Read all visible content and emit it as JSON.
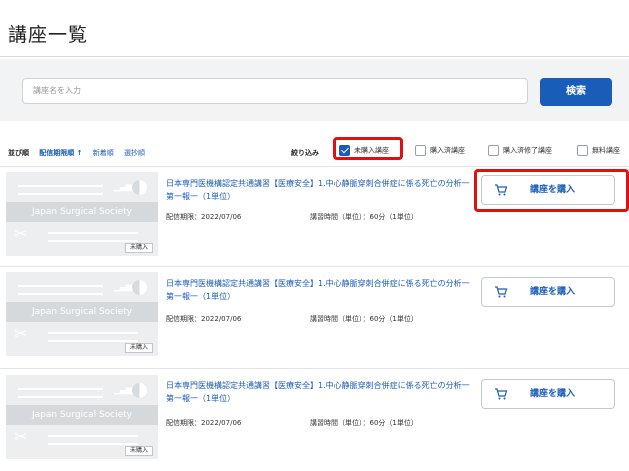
{
  "page": {
    "title": "講座一覧"
  },
  "search": {
    "placeholder": "講座名を入力",
    "button_label": "検索"
  },
  "sort": {
    "label": "並び順",
    "options": [
      {
        "label": "配信期限順 ↑",
        "active": true
      },
      {
        "label": "新着順",
        "active": false
      },
      {
        "label": "選抄順",
        "active": false
      }
    ]
  },
  "filter": {
    "label": "絞り込み",
    "options": [
      {
        "label": "未購入講座",
        "checked": true
      },
      {
        "label": "購入済講座",
        "checked": false
      },
      {
        "label": "購入済修了講座",
        "checked": false
      },
      {
        "label": "無料講座",
        "checked": false
      }
    ]
  },
  "courses": [
    {
      "title": "日本専門医機構認定共通講習【医療安全】1.中心静脈穿刺合併症に係る死亡の分析一第一報一（1単位）",
      "thumb_society": "Japan Surgical Society",
      "thumb_tag": "未購入",
      "deadline": "配信期限：2022/07/06",
      "hours": "講習時間（単位）：60分（1単位）",
      "buy_label": "講座を購入"
    },
    {
      "title": "日本専門医機構認定共通講習【医療安全】1.中心静脈穿刺合併症に係る死亡の分析一第一報一（1単位）",
      "thumb_society": "Japan Surgical Society",
      "thumb_tag": "未購入",
      "deadline": "配信期限：2022/07/06",
      "hours": "講習時間（単位）：60分（1単位）",
      "buy_label": "講座を購入"
    },
    {
      "title": "日本専門医機構認定共通講習【医療安全】1.中心静脈穿刺合併症に係る死亡の分析一第一報一（1単位）",
      "thumb_society": "Japan Surgical Society",
      "thumb_tag": "未購入",
      "deadline": "配信期限：2022/07/06",
      "hours": "講習時間（単位）：60分（1単位）",
      "buy_label": "講座を購入"
    }
  ],
  "colors": {
    "accent": "#1a5db8",
    "highlight": "#e01010"
  }
}
